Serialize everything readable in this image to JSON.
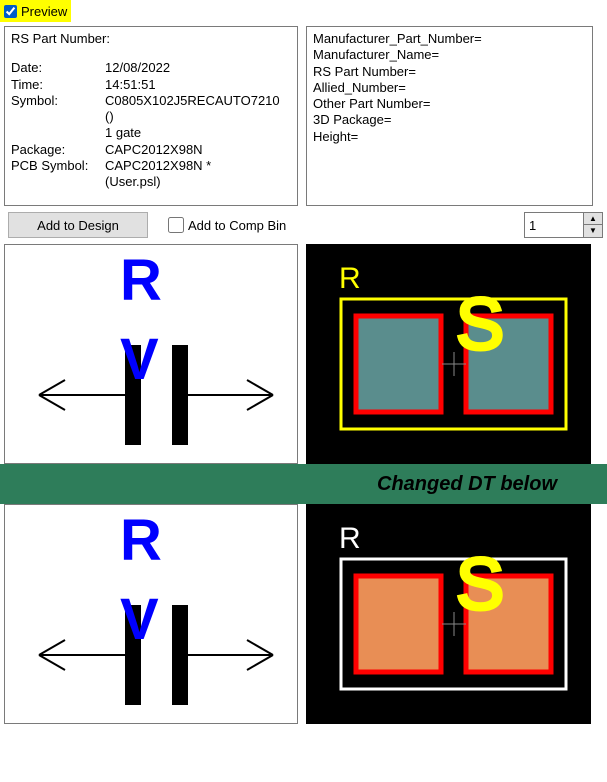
{
  "preview_checkbox": {
    "label": "Preview",
    "checked": true
  },
  "left_panel": {
    "rs_part_label": "RS Part Number:",
    "date_label": "Date:",
    "date_value": "12/08/2022",
    "time_label": "Time:",
    "time_value": "14:51:51",
    "symbol_label": "Symbol:",
    "symbol_value": "C0805X102J5RECAUTO7210",
    "symbol_value2": "()",
    "symbol_value3": "1 gate",
    "package_label": "Package:",
    "package_value": "CAPC2012X98N",
    "pcb_sym_label": "PCB Symbol:",
    "pcb_sym_value": "CAPC2012X98N *",
    "pcb_sym_value2": "(User.psl)"
  },
  "right_panel": {
    "l1": "Manufacturer_Part_Number=",
    "l2": "Manufacturer_Name=",
    "l3": "RS Part Number=",
    "l4": "Allied_Number=",
    "l5": "Other Part Number=",
    "l6": "3D Package=",
    "l7": "Height="
  },
  "controls": {
    "add_design": "Add to Design",
    "add_compbin": "Add to Comp Bin",
    "qty": "1"
  },
  "symbol_preview": {
    "ref_text": "R",
    "val_text": "V"
  },
  "footprint_preview_top": {
    "ref_text": "R",
    "sil_text": "S",
    "outline_color": "#ffff00",
    "pad_outline": "#ff0000",
    "pad_fill": "#5a8d8d"
  },
  "separator_text": "Changed DT below",
  "footprint_preview_bottom": {
    "ref_text": "R",
    "sil_text": "S",
    "outline_color": "#ffffff",
    "pad_outline": "#ff0000",
    "pad_fill": "#e88e55"
  }
}
